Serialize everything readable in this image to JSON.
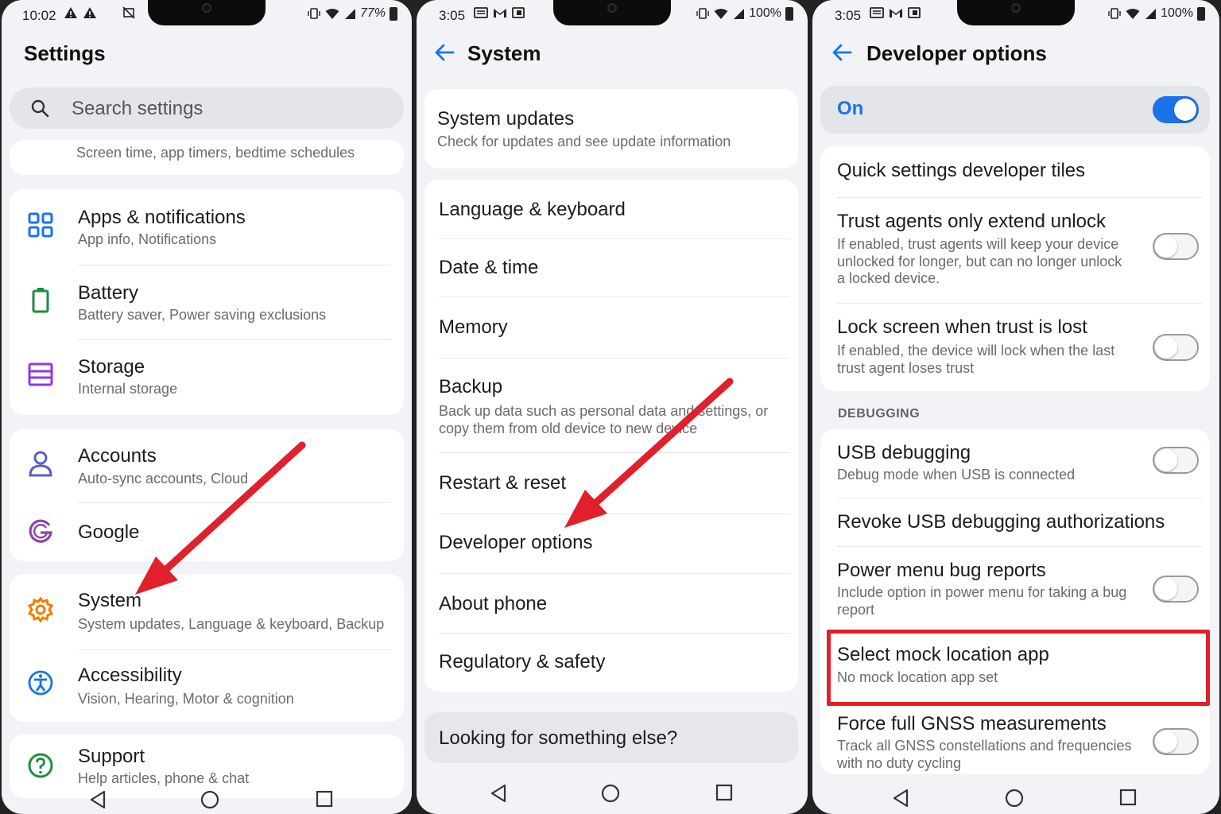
{
  "panel1": {
    "status": {
      "time": "10:02",
      "battery": "77%"
    },
    "title": "Settings",
    "search": {
      "placeholder": "Search settings"
    },
    "partial_item": {
      "subtitle": "Screen time, app timers, bedtime schedules"
    },
    "items": [
      {
        "label": "Apps & notifications",
        "subtitle": "App info, Notifications",
        "icon": "apps-grid-icon",
        "color": "#1a73e8"
      },
      {
        "label": "Battery",
        "subtitle": "Battery saver, Power saving exclusions",
        "icon": "battery-icon",
        "color": "#1e8e3e"
      },
      {
        "label": "Storage",
        "subtitle": "Internal storage",
        "icon": "storage-icon",
        "color": "#9334e6"
      },
      {
        "label": "Accounts",
        "subtitle": "Auto-sync accounts, Cloud",
        "icon": "account-icon",
        "color": "#5b5fc7"
      },
      {
        "label": "Google",
        "subtitle": "",
        "icon": "google-icon",
        "color": "#8e44ad"
      },
      {
        "label": "System",
        "subtitle": "System updates, Language & keyboard, Backup",
        "icon": "gear-icon",
        "color": "#f57c00"
      },
      {
        "label": "Accessibility",
        "subtitle": "Vision, Hearing, Motor & cognition",
        "icon": "accessibility-icon",
        "color": "#1a73e8"
      },
      {
        "label": "Support",
        "subtitle": "Help articles, phone & chat",
        "icon": "help-icon",
        "color": "#1e8e3e"
      }
    ]
  },
  "panel2": {
    "status": {
      "time": "3:05",
      "battery": "100%"
    },
    "title": "System",
    "top_item": {
      "label": "System updates",
      "subtitle": "Check for updates and see update information"
    },
    "items": [
      {
        "label": "Language & keyboard",
        "subtitle": ""
      },
      {
        "label": "Date & time",
        "subtitle": ""
      },
      {
        "label": "Memory",
        "subtitle": ""
      },
      {
        "label": "Backup",
        "subtitle": "Back up data such as personal data and settings, or copy them from old device to new device"
      },
      {
        "label": "Restart & reset",
        "subtitle": ""
      },
      {
        "label": "Developer options",
        "subtitle": ""
      },
      {
        "label": "About phone",
        "subtitle": ""
      },
      {
        "label": "Regulatory & safety",
        "subtitle": ""
      }
    ],
    "footer": "Looking for something else?"
  },
  "panel3": {
    "status": {
      "time": "3:05",
      "battery": "100%"
    },
    "title": "Developer options",
    "master_toggle": {
      "label": "On",
      "state": true
    },
    "items_top": [
      {
        "label": "Quick settings developer tiles",
        "subtitle": "",
        "toggle": null
      },
      {
        "label": "Trust agents only extend unlock",
        "subtitle": "If enabled, trust agents will keep your device unlocked for longer, but can no longer unlock a locked device.",
        "toggle": false
      },
      {
        "label": "Lock screen when trust is lost",
        "subtitle": "If enabled, the device will lock when the last trust agent loses trust",
        "toggle": false
      }
    ],
    "section_header": "DEBUGGING",
    "items_debug": [
      {
        "label": "USB debugging",
        "subtitle": "Debug mode when USB is connected",
        "toggle": false
      },
      {
        "label": "Revoke USB debugging authorizations",
        "subtitle": "",
        "toggle": null
      },
      {
        "label": "Power menu bug reports",
        "subtitle": "Include option in power menu for taking a bug report",
        "toggle": false
      },
      {
        "label": "Select mock location app",
        "subtitle": "No mock location app set",
        "toggle": null
      },
      {
        "label": "Force full GNSS measurements",
        "subtitle": "Track all GNSS constellations and frequencies with no duty cycling",
        "toggle": false
      }
    ]
  },
  "colors": {
    "accent": "#1a73e8",
    "annotation": "#e0202b"
  }
}
